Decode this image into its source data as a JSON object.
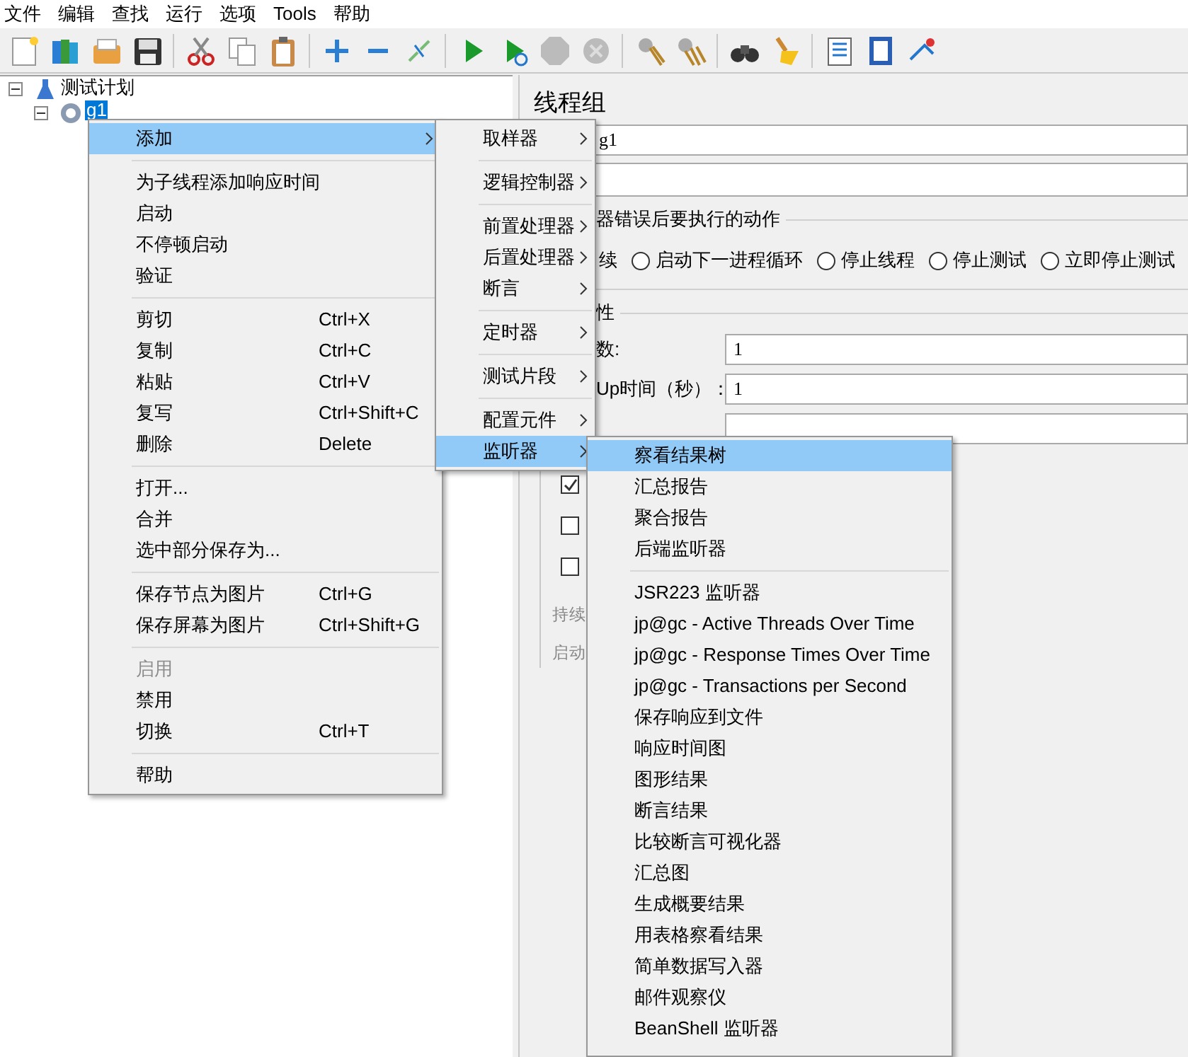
{
  "menu_bar": [
    "文件",
    "编辑",
    "查找",
    "运行",
    "选项",
    "Tools",
    "帮助"
  ],
  "tree": [
    {
      "label": "测试计划",
      "expanded": true,
      "selected": false,
      "children": [
        {
          "label": "g1",
          "expanded": true,
          "selected": true
        }
      ]
    }
  ],
  "thread_group": {
    "title": "线程组",
    "name_value": "g1",
    "error_section": "器错误后要执行的动作",
    "error_actions": [
      {
        "label": "续",
        "kind": "label"
      },
      {
        "label": "启动下一进程循环",
        "kind": "radio",
        "selected": false
      },
      {
        "label": "停止线程",
        "kind": "radio",
        "selected": false
      },
      {
        "label": "停止测试",
        "kind": "radio",
        "selected": false
      },
      {
        "label": "立即停止测试",
        "kind": "radio",
        "selected": false
      }
    ],
    "props_section": "性",
    "fields": [
      {
        "kind": "input",
        "label": "数:",
        "value": "1"
      },
      {
        "kind": "input",
        "label": "Up时间（秒）：",
        "value": "1"
      },
      {
        "kind": "input"
      }
    ],
    "checkboxes": [
      {
        "checked": true
      },
      {
        "checked": false
      },
      {
        "checked": false
      }
    ],
    "greyed_labels": [
      "持续",
      "启动"
    ]
  },
  "context_menu": {
    "groups": [
      [
        {
          "label": "添加",
          "selected": true,
          "disabled": false,
          "submenu": true
        }
      ],
      [
        {
          "label": "为子线程添加响应时间",
          "selected": false,
          "disabled": false
        },
        {
          "label": "启动",
          "selected": false,
          "disabled": false
        },
        {
          "label": "不停顿启动",
          "selected": false,
          "disabled": false
        },
        {
          "label": "验证",
          "selected": false,
          "disabled": false
        }
      ],
      [
        {
          "label": "剪切",
          "shortcut": "Ctrl+X",
          "selected": false,
          "disabled": false
        },
        {
          "label": "复制",
          "shortcut": "Ctrl+C",
          "selected": false,
          "disabled": false
        },
        {
          "label": "粘贴",
          "shortcut": "Ctrl+V",
          "selected": false,
          "disabled": false
        },
        {
          "label": "复写",
          "shortcut": "Ctrl+Shift+C",
          "selected": false,
          "disabled": false
        },
        {
          "label": "删除",
          "shortcut": "Delete",
          "selected": false,
          "disabled": false
        }
      ],
      [
        {
          "label": "打开...",
          "selected": false,
          "disabled": false
        },
        {
          "label": "合并",
          "selected": false,
          "disabled": false
        },
        {
          "label": "选中部分保存为...",
          "selected": false,
          "disabled": false
        }
      ],
      [
        {
          "label": "保存节点为图片",
          "shortcut": "Ctrl+G",
          "selected": false,
          "disabled": false
        },
        {
          "label": "保存屏幕为图片",
          "shortcut": "Ctrl+Shift+G",
          "selected": false,
          "disabled": false
        }
      ],
      [
        {
          "label": "启用",
          "selected": false,
          "disabled": true
        },
        {
          "label": "禁用",
          "selected": false,
          "disabled": false
        },
        {
          "label": "切换",
          "shortcut": "Ctrl+T",
          "selected": false,
          "disabled": false
        }
      ],
      [
        {
          "label": "帮助",
          "selected": false,
          "disabled": false
        }
      ]
    ]
  },
  "add_submenu": {
    "groups": [
      [
        {
          "label": "取样器",
          "submenu": true,
          "selected": false
        }
      ],
      [
        {
          "label": "逻辑控制器",
          "submenu": true,
          "selected": false
        }
      ],
      [
        {
          "label": "前置处理器",
          "submenu": true,
          "selected": false
        },
        {
          "label": "后置处理器",
          "submenu": true,
          "selected": false
        },
        {
          "label": "断言",
          "submenu": true,
          "selected": false
        }
      ],
      [
        {
          "label": "定时器",
          "submenu": true,
          "selected": false
        }
      ],
      [
        {
          "label": "测试片段",
          "submenu": true,
          "selected": false
        }
      ],
      [
        {
          "label": "配置元件",
          "submenu": true,
          "selected": false
        },
        {
          "label": "监听器",
          "submenu": true,
          "selected": true
        }
      ]
    ]
  },
  "listener_submenu": {
    "groups": [
      [
        {
          "label": "察看结果树",
          "selected": true
        },
        {
          "label": "汇总报告",
          "selected": false
        },
        {
          "label": "聚合报告",
          "selected": false
        },
        {
          "label": "后端监听器",
          "selected": false
        }
      ],
      [
        {
          "label": "JSR223 监听器",
          "selected": false
        },
        {
          "label": "jp@gc - Active Threads Over Time",
          "selected": false
        },
        {
          "label": "jp@gc - Response Times Over Time",
          "selected": false
        },
        {
          "label": "jp@gc - Transactions per Second",
          "selected": false
        },
        {
          "label": "保存响应到文件",
          "selected": false
        },
        {
          "label": "响应时间图",
          "selected": false
        },
        {
          "label": "图形结果",
          "selected": false
        },
        {
          "label": "断言结果",
          "selected": false
        },
        {
          "label": "比较断言可视化器",
          "selected": false
        },
        {
          "label": "汇总图",
          "selected": false
        },
        {
          "label": "生成概要结果",
          "selected": false
        },
        {
          "label": "用表格察看结果",
          "selected": false
        },
        {
          "label": "简单数据写入器",
          "selected": false
        },
        {
          "label": "邮件观察仪",
          "selected": false
        },
        {
          "label": "BeanShell 监听器",
          "selected": false
        }
      ]
    ]
  }
}
